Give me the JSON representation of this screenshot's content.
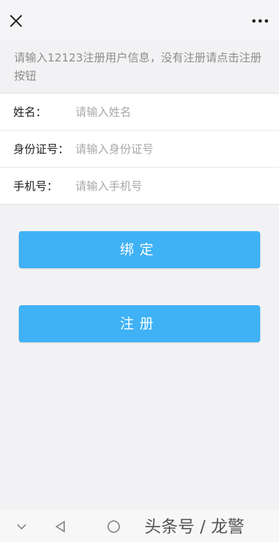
{
  "header": {
    "close_icon": "close-icon",
    "more_icon": "more-icon"
  },
  "notice": {
    "text": "请输入12123注册用户信息，没有注册请点击注册按钮"
  },
  "form": {
    "name": {
      "label": "姓名：",
      "placeholder": "请输入姓名"
    },
    "id_number": {
      "label": "身份证号：",
      "placeholder": "请输入身份证号"
    },
    "phone": {
      "label": "手机号：",
      "placeholder": "请输入手机号"
    }
  },
  "actions": {
    "bind_label": "绑定",
    "register_label": "注册"
  },
  "navbar": {
    "watermark": "头条号 / 龙警"
  },
  "colors": {
    "button": "#3fb1f5",
    "background": "#f2f2f4",
    "placeholder": "#a8a8a8",
    "notice_text": "#8d8d8d"
  }
}
